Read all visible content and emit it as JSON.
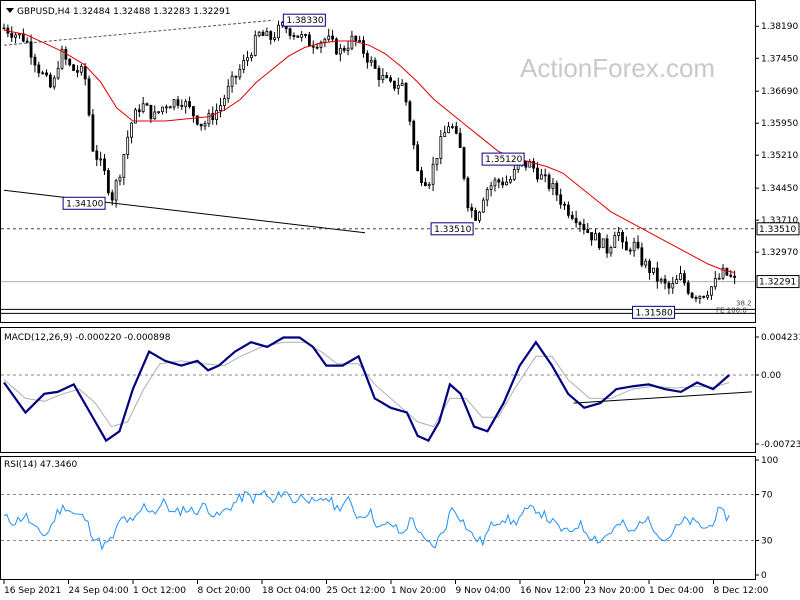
{
  "header": {
    "symbol_line": "GBPUSD,H4  1.32484 1.32488 1.32283 1.32291",
    "watermark": "ActionForex.com"
  },
  "colors": {
    "candles": "#000000",
    "ma": "#e00000",
    "macd": "#000080",
    "signal": "#b0b0b0",
    "rsi": "#1e90ff",
    "border": "#000000",
    "dotted": "#888888"
  },
  "chart_data": [
    {
      "type": "candlestick",
      "panel": "price",
      "title": "GBPUSD,H4",
      "ylim": [
        1.3138,
        1.3875
      ],
      "y_ticks": [
        "1.38190",
        "1.37450",
        "1.36690",
        "1.35950",
        "1.35210",
        "1.34450",
        "1.33710",
        "1.32970"
      ],
      "current_price": "1.32291",
      "horizontal_level": "1.33510",
      "price_labels": [
        {
          "label": "1.38330",
          "x": 10.4,
          "y": 1.3833
        },
        {
          "label": "1.34100",
          "x": 2.2,
          "y": 1.341
        },
        {
          "label": "1.33510",
          "x": 15.9,
          "y": 1.3351
        },
        {
          "label": "1.35120",
          "x": 17.8,
          "y": 1.3512
        },
        {
          "label": "1.31580",
          "x": 23.4,
          "y": 1.3158
        }
      ],
      "small_labels": [
        "38.2",
        "FE 100.0"
      ],
      "x_labels": [
        "16 Sep 2021",
        "24 Sep 04:00",
        "1 Oct 12:00",
        "8 Oct 20:00",
        "18 Oct 04:00",
        "25 Oct 12:00",
        "1 Nov 20:00",
        "9 Nov 04:00",
        "16 Nov 12:00",
        "23 Nov 20:00",
        "1 Dec 04:00",
        "8 Dec 12:00"
      ],
      "close_path": [
        [
          0,
          1.3815
        ],
        [
          0.8,
          1.379
        ],
        [
          1.3,
          1.372
        ],
        [
          1.8,
          1.367
        ],
        [
          2.1,
          1.376
        ],
        [
          2.5,
          1.372
        ],
        [
          3.0,
          1.371
        ],
        [
          3.3,
          1.354
        ],
        [
          3.8,
          1.347
        ],
        [
          4.0,
          1.342
        ],
        [
          4.3,
          1.348
        ],
        [
          4.7,
          1.359
        ],
        [
          5.1,
          1.364
        ],
        [
          5.6,
          1.361
        ],
        [
          6.0,
          1.364
        ],
        [
          6.6,
          1.365
        ],
        [
          7.0,
          1.362
        ],
        [
          7.4,
          1.359
        ],
        [
          8.0,
          1.363
        ],
        [
          8.5,
          1.369
        ],
        [
          9.0,
          1.374
        ],
        [
          9.5,
          1.38
        ],
        [
          9.9,
          1.379
        ],
        [
          10.4,
          1.382
        ],
        [
          10.9,
          1.38
        ],
        [
          11.4,
          1.378
        ],
        [
          12.0,
          1.379
        ],
        [
          12.5,
          1.376
        ],
        [
          13.0,
          1.379
        ],
        [
          13.4,
          1.376
        ],
        [
          13.9,
          1.371
        ],
        [
          14.4,
          1.368
        ],
        [
          14.8,
          1.369
        ],
        [
          15.1,
          1.361
        ],
        [
          15.4,
          1.348
        ],
        [
          15.8,
          1.346
        ],
        [
          16.2,
          1.354
        ],
        [
          16.6,
          1.36
        ],
        [
          17.0,
          1.353
        ],
        [
          17.3,
          1.34
        ],
        [
          17.6,
          1.338
        ],
        [
          17.9,
          1.344
        ],
        [
          18.3,
          1.346
        ],
        [
          18.8,
          1.346
        ],
        [
          19.2,
          1.35
        ],
        [
          19.6,
          1.35
        ],
        [
          20.0,
          1.347
        ],
        [
          20.5,
          1.344
        ],
        [
          20.9,
          1.34
        ],
        [
          21.3,
          1.338
        ],
        [
          21.8,
          1.334
        ],
        [
          22.2,
          1.332
        ],
        [
          22.5,
          1.33
        ],
        [
          22.8,
          1.336
        ],
        [
          23.1,
          1.329
        ],
        [
          23.4,
          1.332
        ],
        [
          23.7,
          1.328
        ],
        [
          24.0,
          1.326
        ],
        [
          24.4,
          1.323
        ],
        [
          24.8,
          1.321
        ],
        [
          25.2,
          1.324
        ],
        [
          25.6,
          1.32
        ],
        [
          26.0,
          1.32
        ],
        [
          26.4,
          1.322
        ],
        [
          26.8,
          1.325
        ],
        [
          27.2,
          1.323
        ]
      ],
      "ma_path": [
        [
          0,
          1.381
        ],
        [
          0.8,
          1.38
        ],
        [
          1.5,
          1.378
        ],
        [
          2.2,
          1.376
        ],
        [
          3.0,
          1.373
        ],
        [
          3.6,
          1.369
        ],
        [
          4.2,
          1.363
        ],
        [
          4.8,
          1.36
        ],
        [
          5.4,
          1.36
        ],
        [
          6.0,
          1.36
        ],
        [
          6.8,
          1.3605
        ],
        [
          7.6,
          1.361
        ],
        [
          8.2,
          1.3625
        ],
        [
          8.8,
          1.365
        ],
        [
          9.4,
          1.369
        ],
        [
          10.0,
          1.372
        ],
        [
          10.6,
          1.375
        ],
        [
          11.2,
          1.377
        ],
        [
          11.8,
          1.378
        ],
        [
          12.4,
          1.3785
        ],
        [
          13.0,
          1.3785
        ],
        [
          13.6,
          1.3775
        ],
        [
          14.2,
          1.3755
        ],
        [
          14.8,
          1.3725
        ],
        [
          15.4,
          1.369
        ],
        [
          16.0,
          1.365
        ],
        [
          16.6,
          1.362
        ],
        [
          17.2,
          1.359
        ],
        [
          17.8,
          1.356
        ],
        [
          18.4,
          1.353
        ],
        [
          19.0,
          1.3515
        ],
        [
          19.6,
          1.3505
        ],
        [
          20.2,
          1.3495
        ],
        [
          20.8,
          1.348
        ],
        [
          21.4,
          1.345
        ],
        [
          22.0,
          1.342
        ],
        [
          22.6,
          1.339
        ],
        [
          23.2,
          1.337
        ],
        [
          23.8,
          1.335
        ],
        [
          24.4,
          1.333
        ],
        [
          25.0,
          1.331
        ],
        [
          25.6,
          1.329
        ],
        [
          26.2,
          1.327
        ],
        [
          26.8,
          1.3255
        ],
        [
          27.2,
          1.325
        ]
      ]
    },
    {
      "type": "line",
      "panel": "macd",
      "title": "MACD(12,26,9) -0.000220 -0.000898",
      "ylim": [
        -0.0008,
        0.00048
      ],
      "y_ticks": [
        "0.004231",
        "0.00",
        "-0.00723"
      ],
      "series": [
        {
          "role": "macd",
          "values": [
            [
              0,
              -8e-05
            ],
            [
              0.8,
              -0.0004
            ],
            [
              1.5,
              -0.0002
            ],
            [
              2.0,
              -0.00018
            ],
            [
              2.6,
              -0.0001
            ],
            [
              3.2,
              -0.0004
            ],
            [
              3.8,
              -0.0007
            ],
            [
              4.3,
              -0.0006
            ],
            [
              4.8,
              -0.00015
            ],
            [
              5.4,
              0.00025
            ],
            [
              6.0,
              0.00015
            ],
            [
              6.6,
              0.0001
            ],
            [
              7.2,
              0.00015
            ],
            [
              7.6,
              5e-05
            ],
            [
              8.0,
              0.0001
            ],
            [
              8.6,
              0.00025
            ],
            [
              9.2,
              0.00035
            ],
            [
              9.8,
              0.0003
            ],
            [
              10.4,
              0.0004
            ],
            [
              11.0,
              0.0004
            ],
            [
              11.5,
              0.0003
            ],
            [
              12.0,
              0.0001
            ],
            [
              12.6,
              0.0001
            ],
            [
              13.2,
              0.0002
            ],
            [
              13.8,
              -0.00025
            ],
            [
              14.4,
              -0.00035
            ],
            [
              15.0,
              -0.0004
            ],
            [
              15.4,
              -0.00065
            ],
            [
              15.8,
              -0.0007
            ],
            [
              16.2,
              -0.0005
            ],
            [
              16.6,
              -0.0001
            ],
            [
              17.0,
              -0.0002
            ],
            [
              17.5,
              -0.00055
            ],
            [
              18.0,
              -0.0006
            ],
            [
              18.6,
              -0.0003
            ],
            [
              19.2,
              0.0001
            ],
            [
              19.8,
              0.00035
            ],
            [
              20.4,
              0.0001
            ],
            [
              21.0,
              -0.0002
            ],
            [
              21.6,
              -0.00035
            ],
            [
              22.2,
              -0.0003
            ],
            [
              22.8,
              -0.00015
            ],
            [
              23.4,
              -0.00012
            ],
            [
              24.0,
              -0.0001
            ],
            [
              24.6,
              -0.00015
            ],
            [
              25.2,
              -0.00018
            ],
            [
              25.8,
              -8e-05
            ],
            [
              26.4,
              -0.00015
            ],
            [
              27.0,
              0.0
            ]
          ]
        },
        {
          "role": "signal",
          "values": [
            [
              0,
              -5e-05
            ],
            [
              0.8,
              -0.00025
            ],
            [
              1.5,
              -0.00028
            ],
            [
              2.2,
              -0.0002
            ],
            [
              2.8,
              -0.00015
            ],
            [
              3.4,
              -0.0003
            ],
            [
              4.0,
              -0.00055
            ],
            [
              4.6,
              -0.0005
            ],
            [
              5.2,
              -0.00015
            ],
            [
              5.8,
              0.00012
            ],
            [
              6.6,
              0.00015
            ],
            [
              7.4,
              0.00012
            ],
            [
              8.2,
              0.0001
            ],
            [
              8.8,
              0.0002
            ],
            [
              9.6,
              0.0003
            ],
            [
              10.4,
              0.00035
            ],
            [
              11.2,
              0.00035
            ],
            [
              11.8,
              0.00025
            ],
            [
              12.4,
              0.00012
            ],
            [
              13.2,
              0.00012
            ],
            [
              13.8,
              -0.0001
            ],
            [
              14.6,
              -0.0003
            ],
            [
              15.4,
              -0.0005
            ],
            [
              16.0,
              -0.00055
            ],
            [
              16.6,
              -0.00025
            ],
            [
              17.2,
              -0.00025
            ],
            [
              17.8,
              -0.00045
            ],
            [
              18.4,
              -0.00045
            ],
            [
              19.0,
              -0.00015
            ],
            [
              19.8,
              0.0002
            ],
            [
              20.4,
              0.0002
            ],
            [
              21.0,
              -5e-05
            ],
            [
              21.8,
              -0.00025
            ],
            [
              22.6,
              -0.00025
            ],
            [
              23.4,
              -0.00015
            ],
            [
              24.2,
              -0.00012
            ],
            [
              25.0,
              -0.00014
            ],
            [
              25.8,
              -0.00012
            ],
            [
              26.4,
              -0.00013
            ],
            [
              27.0,
              -8e-05
            ]
          ]
        }
      ],
      "trendline": [
        [
          21.2,
          -0.0003
        ],
        [
          27.4,
          -0.00018
        ]
      ]
    },
    {
      "type": "line",
      "panel": "rsi",
      "title": "RSI(14) 47.3460",
      "ylim": [
        0,
        100
      ],
      "y_ticks": [
        "100",
        "70",
        "30",
        "0"
      ],
      "levels": [
        70,
        30
      ],
      "series": [
        {
          "role": "rsi",
          "values": [
            [
              0,
              50
            ],
            [
              0.4,
              46
            ],
            [
              0.8,
              52
            ],
            [
              1.2,
              38
            ],
            [
              1.6,
              35
            ],
            [
              2.0,
              55
            ],
            [
              2.3,
              60
            ],
            [
              2.6,
              53
            ],
            [
              3.0,
              50
            ],
            [
              3.3,
              35
            ],
            [
              3.7,
              25
            ],
            [
              4.0,
              30
            ],
            [
              4.4,
              50
            ],
            [
              4.8,
              45
            ],
            [
              5.2,
              60
            ],
            [
              5.6,
              55
            ],
            [
              6.0,
              64
            ],
            [
              6.3,
              52
            ],
            [
              6.7,
              58
            ],
            [
              7.1,
              55
            ],
            [
              7.5,
              61
            ],
            [
              7.9,
              50
            ],
            [
              8.3,
              57
            ],
            [
              8.7,
              65
            ],
            [
              9.0,
              70
            ],
            [
              9.3,
              66
            ],
            [
              9.7,
              72
            ],
            [
              10.0,
              62
            ],
            [
              10.4,
              74
            ],
            [
              10.8,
              64
            ],
            [
              11.2,
              70
            ],
            [
              11.6,
              60
            ],
            [
              12.0,
              68
            ],
            [
              12.4,
              58
            ],
            [
              12.8,
              65
            ],
            [
              13.2,
              50
            ],
            [
              13.6,
              56
            ],
            [
              14.0,
              40
            ],
            [
              14.4,
              45
            ],
            [
              14.8,
              35
            ],
            [
              15.2,
              50
            ],
            [
              15.6,
              30
            ],
            [
              16.0,
              24
            ],
            [
              16.4,
              40
            ],
            [
              16.7,
              60
            ],
            [
              17.0,
              50
            ],
            [
              17.4,
              35
            ],
            [
              17.8,
              28
            ],
            [
              18.2,
              45
            ],
            [
              18.6,
              50
            ],
            [
              19.0,
              45
            ],
            [
              19.4,
              55
            ],
            [
              19.8,
              58
            ],
            [
              20.2,
              50
            ],
            [
              20.6,
              42
            ],
            [
              21.0,
              36
            ],
            [
              21.4,
              45
            ],
            [
              21.8,
              35
            ],
            [
              22.2,
              30
            ],
            [
              22.6,
              38
            ],
            [
              23.0,
              45
            ],
            [
              23.4,
              35
            ],
            [
              23.8,
              50
            ],
            [
              24.2,
              42
            ],
            [
              24.6,
              30
            ],
            [
              25.0,
              40
            ],
            [
              25.4,
              48
            ],
            [
              25.8,
              44
            ],
            [
              26.2,
              40
            ],
            [
              26.6,
              55
            ],
            [
              27.0,
              50
            ]
          ]
        }
      ]
    }
  ]
}
